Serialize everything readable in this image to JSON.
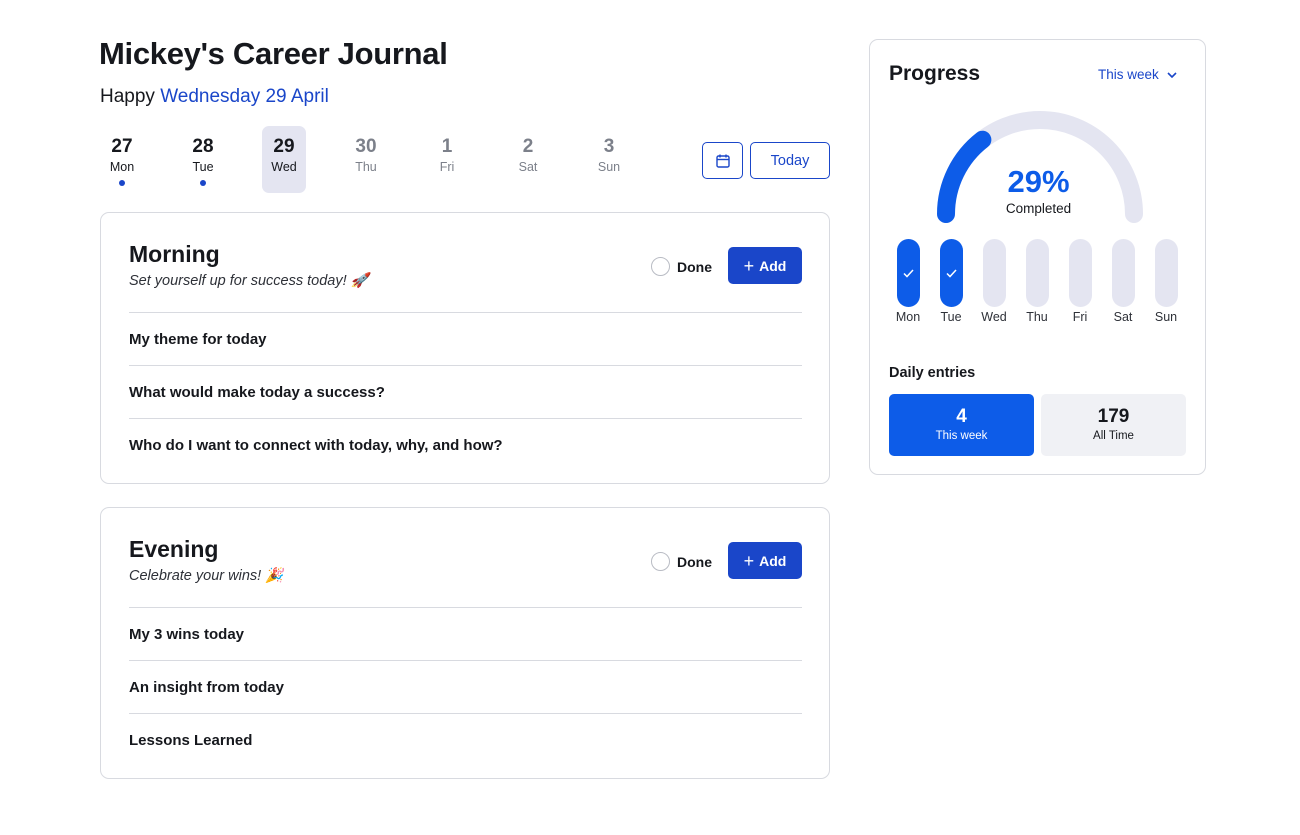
{
  "header": {
    "title": "Mickey's Career Journal",
    "greeting_prefix": "Happy",
    "greeting_date": "Wednesday 29 April"
  },
  "week_strip": {
    "days": [
      {
        "num": "27",
        "name": "Mon",
        "has_entry": true,
        "state": "past"
      },
      {
        "num": "28",
        "name": "Tue",
        "has_entry": true,
        "state": "past"
      },
      {
        "num": "29",
        "name": "Wed",
        "has_entry": false,
        "state": "selected"
      },
      {
        "num": "30",
        "name": "Thu",
        "has_entry": false,
        "state": "future"
      },
      {
        "num": "1",
        "name": "Fri",
        "has_entry": false,
        "state": "future"
      },
      {
        "num": "2",
        "name": "Sat",
        "has_entry": false,
        "state": "future"
      },
      {
        "num": "3",
        "name": "Sun",
        "has_entry": false,
        "state": "future"
      }
    ],
    "calendar_icon": "calendar-icon",
    "today_label": "Today"
  },
  "morning": {
    "title": "Morning",
    "subtitle": "Set yourself up for success today! 🚀",
    "done_label": "Done",
    "add_label": "Add",
    "prompts": [
      "My theme for today",
      "What would make today a success?",
      "Who do I want to connect with today, why, and how?"
    ]
  },
  "evening": {
    "title": "Evening",
    "subtitle": "Celebrate your wins! 🎉",
    "done_label": "Done",
    "add_label": "Add",
    "prompts": [
      "My 3 wins today",
      "An insight from today",
      "Lessons Learned"
    ]
  },
  "progress": {
    "title": "Progress",
    "period": "This week",
    "percent_value": 0.29,
    "percent_label": "29%",
    "completed_label": "Completed",
    "week": [
      {
        "day": "Mon",
        "done": true
      },
      {
        "day": "Tue",
        "done": true
      },
      {
        "day": "Wed",
        "done": false
      },
      {
        "day": "Thu",
        "done": false
      },
      {
        "day": "Fri",
        "done": false
      },
      {
        "day": "Sat",
        "done": false
      },
      {
        "day": "Sun",
        "done": false
      }
    ],
    "entries_title": "Daily entries",
    "this_week_value": "4",
    "this_week_label": "This week",
    "all_time_value": "179",
    "all_time_label": "All Time"
  },
  "colors": {
    "accent": "#1a46c9",
    "progress_blue": "#0d5ce8",
    "track": "#e4e5f1"
  }
}
